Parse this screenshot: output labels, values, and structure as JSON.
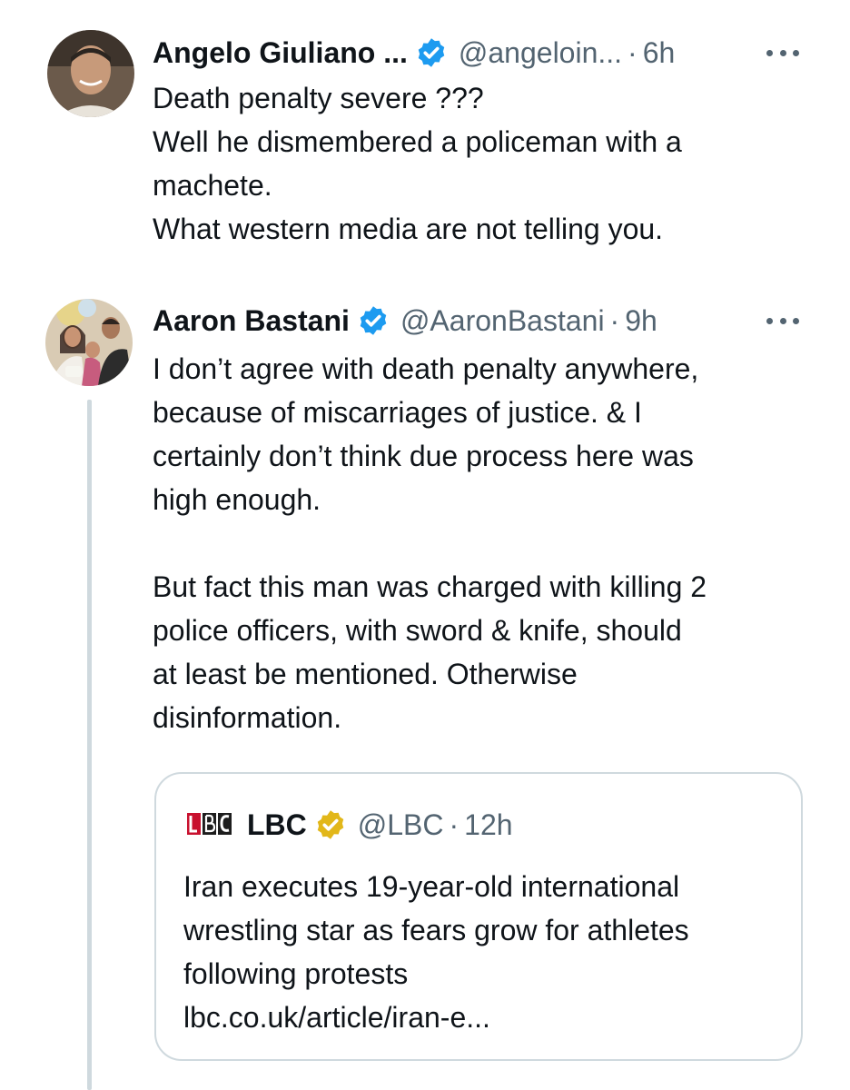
{
  "tweet1": {
    "name": "Angelo Giuliano ...",
    "handle": "@angeloin...",
    "separator": "·",
    "time": "6h",
    "verified": true,
    "badge_color": "#1d9bf0",
    "lines": [
      "Death penalty severe ???",
      "Well he dismembered a policeman with a",
      "machete.",
      "What western media are not telling  you."
    ]
  },
  "tweet2": {
    "name": "Aaron Bastani",
    "handle": "@AaronBastani",
    "separator": "·",
    "time": "9h",
    "verified": true,
    "badge_color": "#1d9bf0",
    "paragraph1": [
      "I don’t agree with death penalty anywhere,",
      "because of miscarriages of justice. & I",
      "certainly don’t think due process here was",
      "high enough."
    ],
    "paragraph2": [
      "But fact this man was charged with killing 2",
      "police officers, with sword & knife, should",
      "at least be mentioned. Otherwise",
      "disinformation."
    ]
  },
  "quote": {
    "logo_text": "LBC",
    "name": "LBC",
    "handle": "@LBC",
    "separator": "·",
    "time": "12h",
    "verified": true,
    "badge_color": "#e2b719",
    "lines": [
      "Iran executes 19-year-old international",
      "wrestling star as fears grow for athletes",
      "following protests",
      "lbc.co.uk/article/iran-e..."
    ]
  },
  "icons": {
    "verified": "verified-badge-icon",
    "gold_verified": "gold-verified-badge-icon",
    "more": "more-options-icon"
  },
  "colors": {
    "text": "#0f1419",
    "secondary": "#536471",
    "border": "#cfd9de"
  }
}
